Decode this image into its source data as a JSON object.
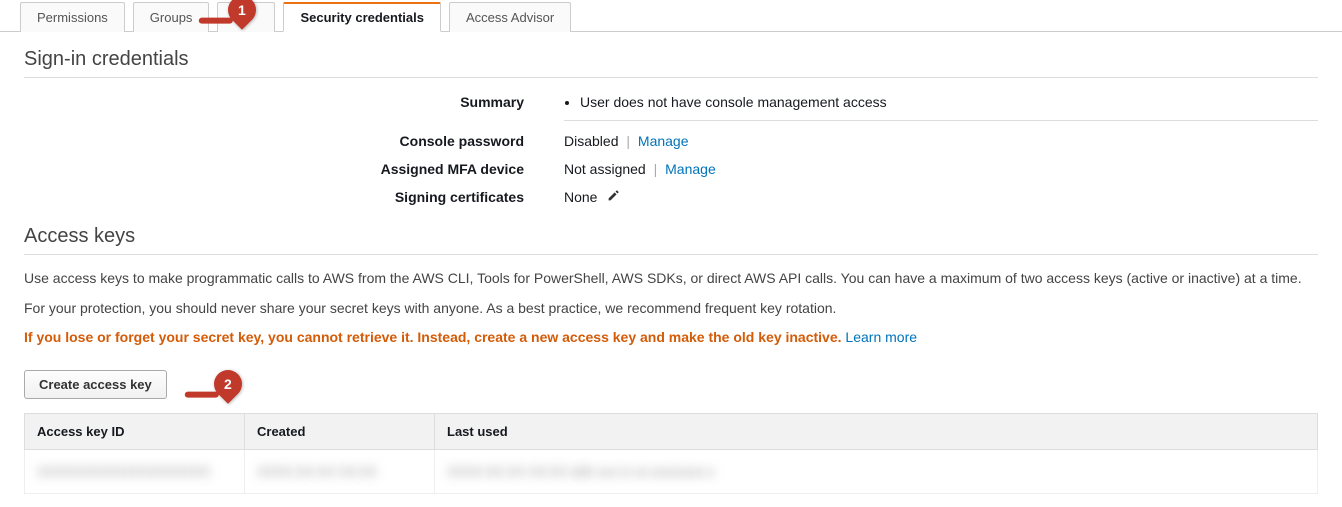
{
  "tabs": {
    "permissions": "Permissions",
    "groups": "Groups",
    "hidden": "T",
    "security_credentials": "Security credentials",
    "access_advisor": "Access Advisor"
  },
  "callouts": {
    "one": "1",
    "two": "2"
  },
  "signin": {
    "title": "Sign-in credentials",
    "summary_label": "Summary",
    "summary_item": "User does not have console management access",
    "console_pw_label": "Console password",
    "console_pw_value": "Disabled",
    "console_pw_manage": "Manage",
    "mfa_label": "Assigned MFA device",
    "mfa_value": "Not assigned",
    "mfa_manage": "Manage",
    "signing_label": "Signing certificates",
    "signing_value": "None"
  },
  "access_keys": {
    "title": "Access keys",
    "desc1": "Use access keys to make programmatic calls to AWS from the AWS CLI, Tools for PowerShell, AWS SDKs, or direct AWS API calls. You can have a maximum of two access keys (active or inactive) at a time.",
    "desc2": "For your protection, you should never share your secret keys with anyone. As a best practice, we recommend frequent key rotation.",
    "warn": "If you lose or forget your secret key, you cannot retrieve it. Instead, create a new access key and make the old key inactive.",
    "learn_more": "Learn more",
    "create_btn": "Create access key",
    "columns": {
      "id": "Access key ID",
      "created": "Created",
      "last_used": "Last used"
    },
    "row": {
      "id": "XXXXXXXXXXXXXXXXXXXX",
      "created": "XXXX-XX-XX XX:XX",
      "last_used": "XXXX-XX-XX XX:XX with xxx in xx-xxxxxxxx-x"
    }
  }
}
